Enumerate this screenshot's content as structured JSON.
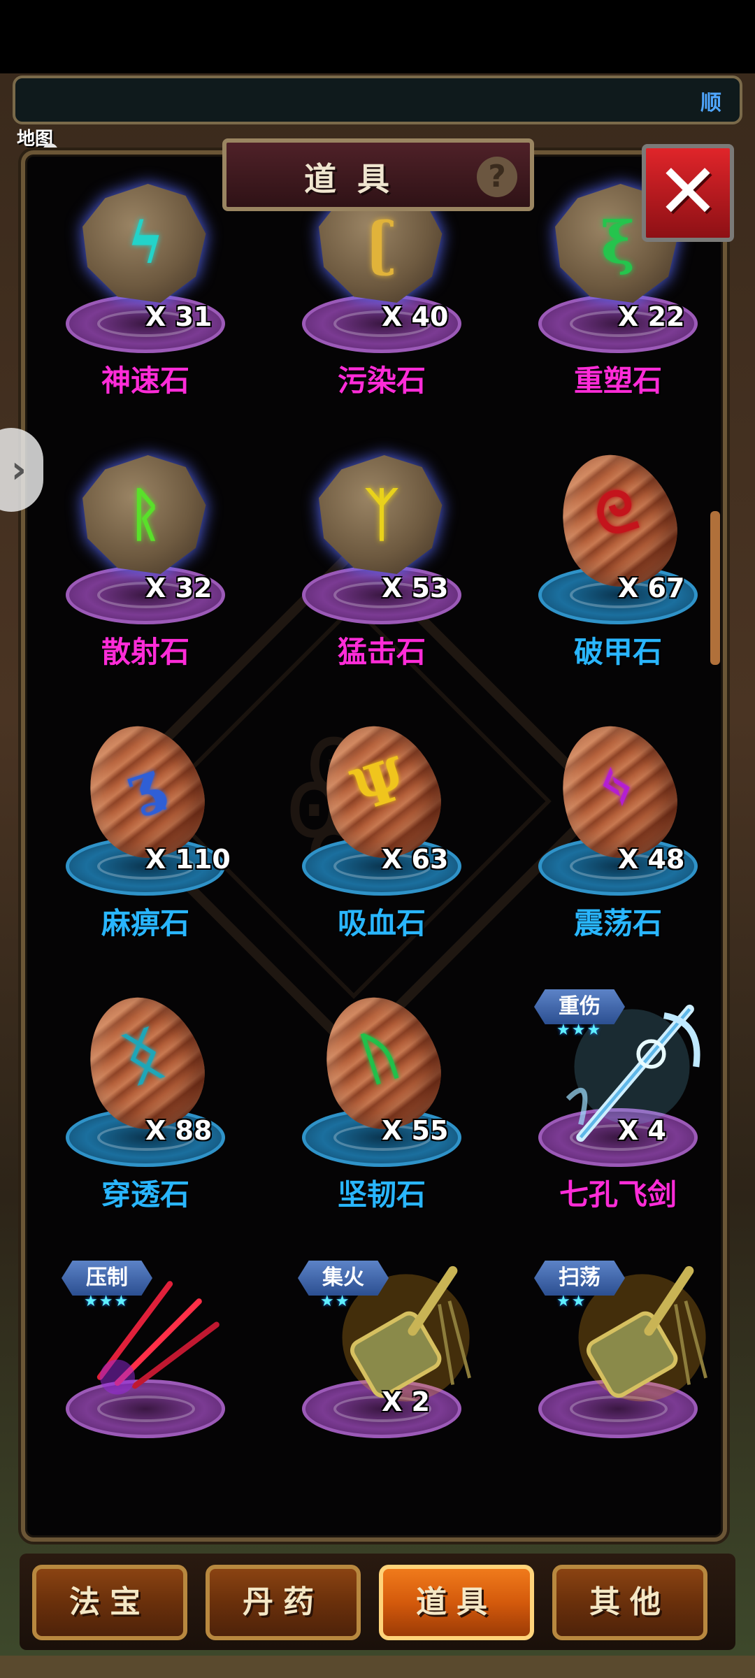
{
  "header": {
    "title": "道具",
    "help": "?",
    "close": "✕",
    "tracker_text": "顺",
    "map_label": "地图"
  },
  "side_arrow": "›",
  "emblem_glyph": "ꙮ",
  "items": [
    {
      "name": "神速石",
      "count": "X 31",
      "kind": "stone",
      "glyph": "ϟ",
      "glyph_color": "#23d3c9",
      "pedestal": "purple",
      "name_color": "magenta"
    },
    {
      "name": "污染石",
      "count": "X 40",
      "kind": "stone",
      "glyph": "ʗ",
      "glyph_color": "#e1b33a",
      "pedestal": "purple",
      "name_color": "magenta"
    },
    {
      "name": "重塑石",
      "count": "X 22",
      "kind": "stone",
      "glyph": "ξ",
      "glyph_color": "#25c44d",
      "pedestal": "purple",
      "name_color": "magenta"
    },
    {
      "name": "散射石",
      "count": "X 32",
      "kind": "stone",
      "glyph": "ᚱ",
      "glyph_color": "#59e02a",
      "pedestal": "purple",
      "name_color": "magenta"
    },
    {
      "name": "猛击石",
      "count": "X 53",
      "kind": "stone",
      "glyph": "ᛉ",
      "glyph_color": "#e9d21b",
      "pedestal": "purple",
      "name_color": "magenta"
    },
    {
      "name": "破甲石",
      "count": "X 67",
      "kind": "egg",
      "glyph": "ᘓ",
      "glyph_color": "#c4141c",
      "pedestal": "blue",
      "name_color": "cyan"
    },
    {
      "name": "麻痹石",
      "count": "X 110",
      "kind": "egg",
      "glyph": "ʓ",
      "glyph_color": "#2f5fd6",
      "pedestal": "blue",
      "name_color": "cyan"
    },
    {
      "name": "吸血石",
      "count": "X 63",
      "kind": "egg",
      "glyph": "Ψ",
      "glyph_color": "#f0c51d",
      "pedestal": "blue",
      "name_color": "cyan"
    },
    {
      "name": "震荡石",
      "count": "X 48",
      "kind": "egg",
      "glyph": "ᛃ",
      "glyph_color": "#b41fd1",
      "pedestal": "blue",
      "name_color": "cyan"
    },
    {
      "name": "穿透石",
      "count": "X 88",
      "kind": "egg",
      "glyph": "ᛝ",
      "glyph_color": "#1ea6b8",
      "pedestal": "blue",
      "name_color": "cyan"
    },
    {
      "name": "坚韧石",
      "count": "X 55",
      "kind": "egg",
      "glyph": "ᚢ",
      "glyph_color": "#21c04a",
      "pedestal": "blue",
      "name_color": "cyan"
    },
    {
      "name": "七孔飞剑",
      "count": "X 4",
      "kind": "sword",
      "tag": "重伤",
      "stars": "★★★",
      "pedestal": "purple",
      "name_color": "magenta"
    },
    {
      "name": "",
      "count": "",
      "kind": "claw",
      "tag": "压制",
      "stars": "★★★",
      "pedestal": "purple",
      "name_color": "magenta"
    },
    {
      "name": "",
      "count": "X 2",
      "kind": "mace",
      "tag": "集火",
      "stars": "★★",
      "pedestal": "purple",
      "name_color": "magenta"
    },
    {
      "name": "",
      "count": "",
      "kind": "mace",
      "tag": "扫荡",
      "stars": "★★",
      "pedestal": "purple",
      "name_color": "magenta"
    }
  ],
  "tabs": [
    {
      "label": "法宝",
      "active": false
    },
    {
      "label": "丹药",
      "active": false
    },
    {
      "label": "道具",
      "active": true
    },
    {
      "label": "其他",
      "active": false
    }
  ]
}
